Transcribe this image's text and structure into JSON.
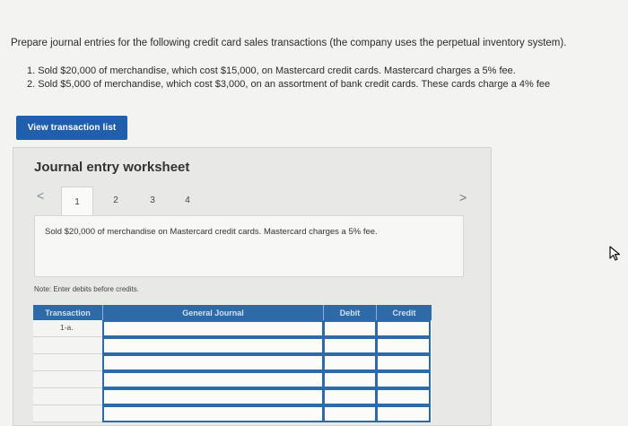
{
  "prompt": "Prepare journal entries for the following credit card sales transactions (the company uses the perpetual inventory system).",
  "transactions": [
    "1. Sold $20,000 of merchandise, which cost $15,000, on Mastercard credit cards. Mastercard charges a 5% fee.",
    "2. Sold $5,000 of merchandise, which cost $3,000, on an assortment of bank credit cards. These cards charge a 4% fee"
  ],
  "view_button_label": "View transaction list",
  "worksheet": {
    "title": "Journal entry worksheet",
    "tabs": [
      "1",
      "2",
      "3",
      "4"
    ],
    "active_tab": "1",
    "description": "Sold $20,000 of merchandise on Mastercard credit cards. Mastercard charges a 5% fee.",
    "note": "Note: Enter debits before credits.",
    "table": {
      "headers": {
        "transaction": "Transaction",
        "general_journal": "General Journal",
        "debit": "Debit",
        "credit": "Credit"
      },
      "rows": [
        {
          "transaction": "1-a."
        },
        {
          "transaction": ""
        },
        {
          "transaction": ""
        },
        {
          "transaction": ""
        },
        {
          "transaction": ""
        },
        {
          "transaction": ""
        }
      ]
    }
  },
  "icons": {
    "prev": "chevron-left-icon",
    "next": "chevron-right-icon",
    "cursor": "mouse-cursor-icon"
  },
  "colors": {
    "accent": "#1f5fae",
    "header": "#2f6aa8"
  }
}
